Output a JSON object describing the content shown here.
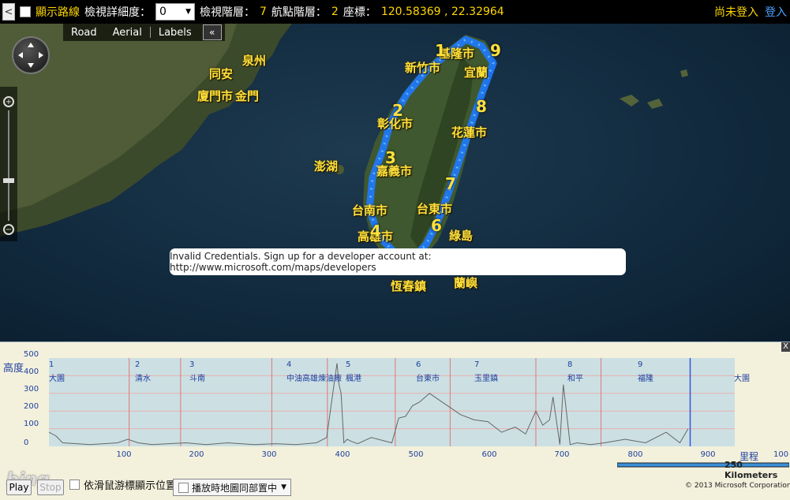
{
  "topbar": {
    "back_label": "<",
    "show_route_label": "顯示路線",
    "detail_label": "檢視詳細度：",
    "detail_value": "0",
    "view_level_label": "檢視階層：",
    "view_level_value": "7",
    "waypoint_level_label": "航點階層：",
    "waypoint_level_value": "2",
    "coords_label": "座標：",
    "coords_value": "120.58369 , 22.32964",
    "not_logged_in": "尚未登入",
    "sign_in": "登入"
  },
  "map": {
    "type_buttons": [
      "Road",
      "Aerial",
      "Labels"
    ],
    "collapse_label": "«",
    "zoom_in": "+",
    "zoom_out": "−",
    "places": [
      "泉州",
      "同安",
      "廈門市",
      "金門",
      "澎湖",
      "新竹市",
      "宜蘭",
      "基隆市",
      "彰化市",
      "嘉義市",
      "花蓮市",
      "台南市",
      "高雄市",
      "台東市",
      "綠島",
      "恆春鎮",
      "蘭嶼"
    ],
    "waypoints": [
      "1",
      "2",
      "3",
      "4",
      "6",
      "7",
      "8",
      "9"
    ],
    "error_message": "Invalid Credentials. Sign up for a developer account at: http://www.microsoft.com/maps/developers",
    "route_color": "#1e7bff"
  },
  "elevation": {
    "y_title": "高度",
    "y_ticks": [
      "500",
      "400",
      "300",
      "200",
      "100",
      "0"
    ],
    "x_ticks": [
      "100",
      "200",
      "300",
      "400",
      "500",
      "600",
      "700",
      "800",
      "900"
    ],
    "x_max": "100",
    "x_title": "里程",
    "waypoints": [
      {
        "num": "1",
        "name": "大園"
      },
      {
        "num": "2",
        "name": "清水"
      },
      {
        "num": "3",
        "name": "斗南"
      },
      {
        "num": "4",
        "name": "中油高雄煉油廠"
      },
      {
        "num": "5",
        "name": "楓港"
      },
      {
        "num": "6",
        "name": "台東市"
      },
      {
        "num": "7",
        "name": "玉里鎮"
      },
      {
        "num": "8",
        "name": "和平"
      },
      {
        "num": "9",
        "name": "福隆"
      },
      {
        "num": "",
        "name": "大園"
      }
    ],
    "close_label": "X"
  },
  "chart_data": {
    "type": "line",
    "title": "",
    "xlabel": "里程",
    "ylabel": "高度",
    "xlim": [
      0,
      1000
    ],
    "ylim": [
      0,
      500
    ],
    "series": [
      {
        "x": [
          0,
          10,
          20,
          40,
          60,
          80,
          100,
          115,
          130,
          150,
          175,
          200,
          230,
          260,
          300,
          330,
          360,
          390,
          405,
          415,
          420,
          423,
          426,
          430,
          435,
          440,
          450,
          470,
          500,
          510,
          520,
          530,
          540,
          555,
          570,
          585,
          600,
          620,
          640,
          660,
          680,
          695,
          710,
          720,
          730,
          735,
          745,
          750,
          760,
          770,
          790,
          810,
          840,
          870,
          900,
          920,
          932
        ],
        "y": [
          80,
          60,
          20,
          15,
          10,
          15,
          20,
          40,
          20,
          10,
          15,
          20,
          10,
          20,
          10,
          15,
          10,
          20,
          50,
          330,
          470,
          350,
          300,
          20,
          40,
          30,
          15,
          50,
          20,
          160,
          170,
          230,
          250,
          300,
          260,
          220,
          180,
          150,
          140,
          80,
          110,
          70,
          200,
          120,
          150,
          280,
          10,
          350,
          10,
          20,
          10,
          20,
          40,
          20,
          80,
          20,
          100
        ]
      }
    ]
  },
  "footer": {
    "brand": "bing",
    "play_label": "Play",
    "stop_label": "Stop",
    "follow_label": "依滑鼠游標顯示位置",
    "sync_label": "播放時地圖同部置中",
    "scale_label": "250 Kilometers",
    "copyright": "© 2013 Microsoft Corporation"
  }
}
